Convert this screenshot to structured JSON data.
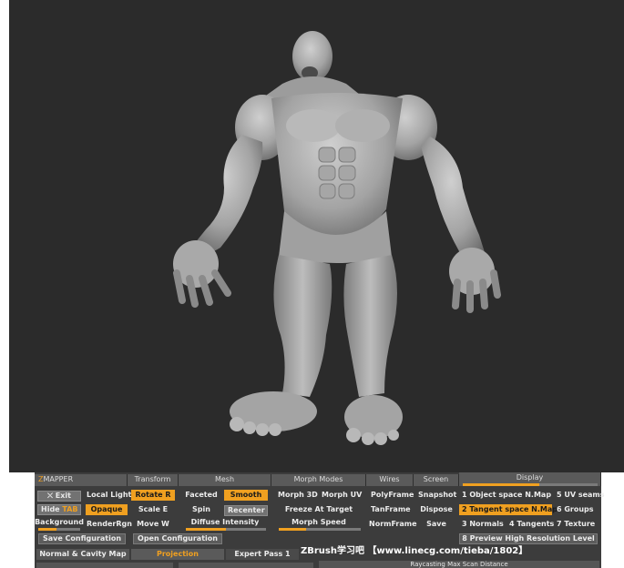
{
  "panel": {
    "title": {
      "z": "Z",
      "rest": "MAPPER"
    },
    "headers": {
      "transform": "Transform",
      "mesh": "Mesh",
      "morph_modes": "Morph Modes",
      "wires": "Wires",
      "screen": "Screen",
      "display": "Display"
    },
    "row1": {
      "exit": "Exit",
      "local_light": "Local Light",
      "rotate": "Rotate R",
      "faceted": "Faceted",
      "smooth": "Smooth",
      "morph3d": "Morph 3D",
      "morph_uv": "Morph UV",
      "polyframe": "PolyFrame",
      "snapshot": "Snapshot",
      "object_space": "1 Object space N.Map",
      "uv_seams": "5 UV seams"
    },
    "row2": {
      "hide": "Hide",
      "hide_key": "TAB",
      "opaque": "Opaque",
      "scale": "Scale E",
      "spin": "Spin",
      "recenter": "Recenter",
      "freeze": "Freeze At Target",
      "tanframe": "TanFrame",
      "dispose": "Dispose",
      "tangent_space": "2 Tangent space N.Map",
      "groups": "6 Groups"
    },
    "row3": {
      "background": "Background",
      "renderrgn": "RenderRgn",
      "move": "Move W",
      "diffuse": "Diffuse Intensity",
      "morph_speed": "Morph Speed",
      "normframe": "NormFrame",
      "save": "Save",
      "normals": "3 Normals",
      "tangents": "4 Tangents",
      "texture": "7 Texture"
    },
    "row4": {
      "save_config": "Save Configuration",
      "open_config": "Open Configuration",
      "preview": "8 Preview High Resolution Level"
    },
    "row5": {
      "normal_cavity": "Normal & Cavity Map",
      "projection": "Projection",
      "expert_pass": "Expert Pass 1",
      "raycasting": "Raycasting Max Scan Distance"
    }
  },
  "watermark": "ZBrush学习吧 【www.linecg.com/tieba/1802】",
  "colors": {
    "accent": "#f0a020",
    "viewport_bg": "#2b2b2b",
    "panel_bg": "#3c3c3c"
  }
}
